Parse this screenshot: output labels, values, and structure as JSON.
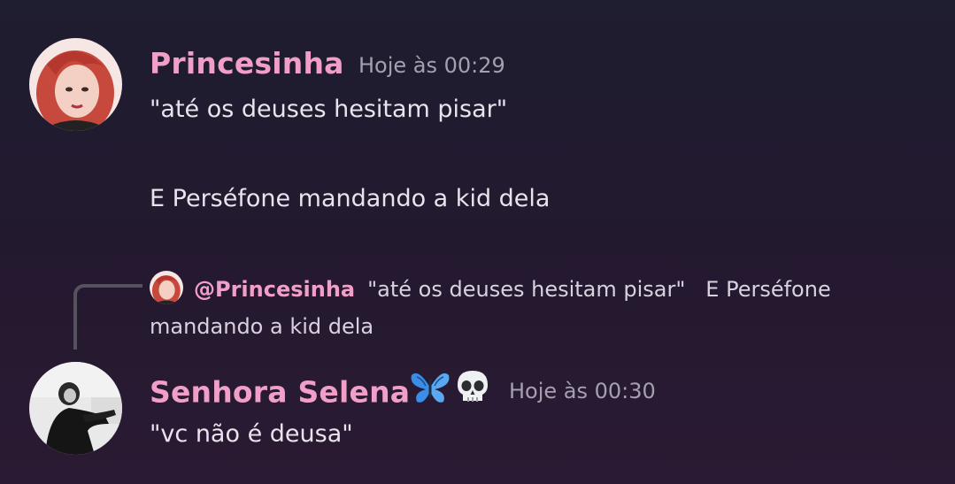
{
  "messages": [
    {
      "author": "Princesinha",
      "timestamp": "Hoje às 00:29",
      "lines": [
        "\"até os deuses hesitam pisar\"",
        "E Perséfone mandando a kid dela"
      ],
      "avatar_icon": "redhead-woman-avatar"
    },
    {
      "author": "Senhora Selena",
      "author_emojis": [
        "butterfly-emoji",
        "skull-emoji"
      ],
      "timestamp": "Hoje às 00:30",
      "lines": [
        "\"vc não é deusa\""
      ],
      "avatar_icon": "grayscale-photo-avatar",
      "reply": {
        "mention": "@Princesinha",
        "text": "\"até os deuses hesitam pisar\"   E Perséfone mandando a kid dela"
      }
    }
  ],
  "colors": {
    "author": "#f19fc8",
    "timestamp": "#a5a0ae",
    "text": "#e8e3ec",
    "background_top": "#1f1d30",
    "background_bottom": "#2a1a33"
  }
}
